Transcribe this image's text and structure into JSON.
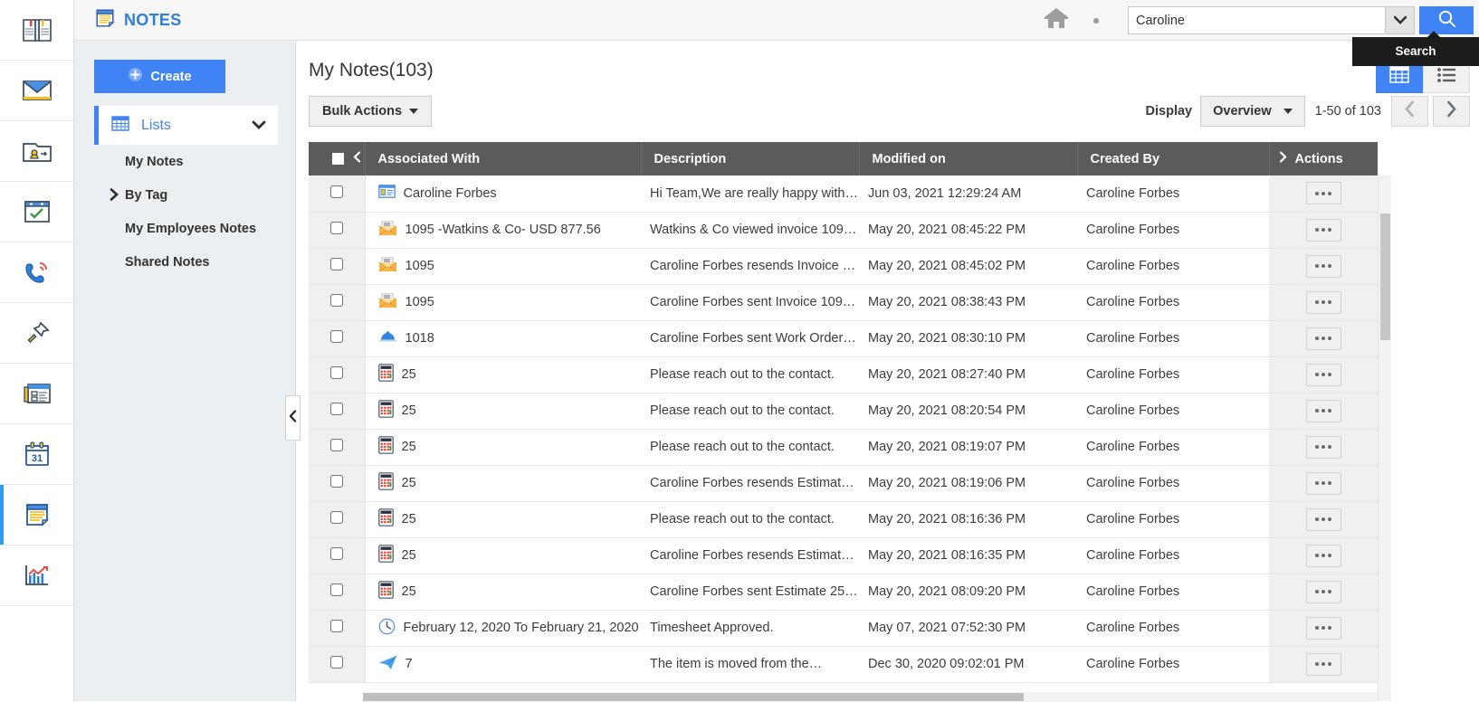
{
  "module": {
    "brand_label": "NOTES",
    "brand_icon": "notes-icon",
    "brand_color": "#2f7ed8"
  },
  "header": {
    "home_icon": "home-icon",
    "more_icon": "ellipsis-icon",
    "search_value": "Caroline",
    "search_placeholder": "Search",
    "search_dropdown_icon": "chevron-down-icon",
    "search_button_icon": "search-icon",
    "tooltip_label": "Search",
    "accent_color": "#3f83f5"
  },
  "icon_rail": [
    {
      "name": "book-icon",
      "label": "Books"
    },
    {
      "name": "envelope-icon",
      "label": "Mail"
    },
    {
      "name": "contacts-icon",
      "label": "Contacts"
    },
    {
      "name": "tasks-icon",
      "label": "Tasks"
    },
    {
      "name": "phone-icon",
      "label": "Calls"
    },
    {
      "name": "pin-icon",
      "label": "Pinned"
    },
    {
      "name": "news-icon",
      "label": "Feeds"
    },
    {
      "name": "calendar-icon",
      "label": "Calendar",
      "badge": "31"
    },
    {
      "name": "notes-icon",
      "label": "Notes",
      "active": true
    },
    {
      "name": "reports-icon",
      "label": "Reports"
    }
  ],
  "nav": {
    "create_label": "Create",
    "create_icon": "plus-circle-icon",
    "lists_label": "Lists",
    "lists_icon": "grid-icon",
    "lists_chevron": "chevron-down-icon",
    "items": [
      {
        "label": "My Notes",
        "has_arrow": false
      },
      {
        "label": "By Tag",
        "has_arrow": true
      },
      {
        "label": "My Employees Notes",
        "has_arrow": false
      },
      {
        "label": "Shared Notes",
        "has_arrow": false
      }
    ],
    "collapse_icon": "chevron-left-icon"
  },
  "main": {
    "page_title": "My Notes(103)",
    "bulk_actions_label": "Bulk Actions",
    "display_label": "Display",
    "display_value": "Overview",
    "range_text": "1-50 of 103",
    "prev_icon": "chevron-left-icon",
    "next_icon": "chevron-right-icon",
    "view_grid_icon": "table-view-icon",
    "view_list_icon": "list-view-icon"
  },
  "table": {
    "select_all_checkbox": false,
    "header_left_chevron": "chevron-left-icon",
    "header_right_chevron": "chevron-right-icon",
    "columns": [
      "Associated With",
      "Description",
      "Modified on",
      "Created By",
      "Actions"
    ],
    "rows": [
      {
        "icon": "contact-card-icon",
        "associated_with": "Caroline Forbes",
        "description": "Hi Team,We are really happy with…",
        "modified_on": "Jun 03, 2021 12:29:24 AM",
        "created_by": "Caroline Forbes",
        "action_icon": "ellipsis-icon"
      },
      {
        "icon": "invoice-envelope-icon",
        "associated_with": "1095 -Watkins & Co- USD 877.56",
        "description": "Watkins & Co viewed invoice 109…",
        "modified_on": "May 20, 2021 08:45:22 PM",
        "created_by": "Caroline Forbes",
        "action_icon": "ellipsis-icon"
      },
      {
        "icon": "invoice-envelope-icon",
        "associated_with": "1095",
        "description": "Caroline Forbes resends Invoice …",
        "modified_on": "May 20, 2021 08:45:02 PM",
        "created_by": "Caroline Forbes",
        "action_icon": "ellipsis-icon"
      },
      {
        "icon": "invoice-envelope-icon",
        "associated_with": "1095",
        "description": "Caroline Forbes sent Invoice 109…",
        "modified_on": "May 20, 2021 08:38:43 PM",
        "created_by": "Caroline Forbes",
        "action_icon": "ellipsis-icon"
      },
      {
        "icon": "hardhat-icon",
        "associated_with": "1018",
        "description": "Caroline Forbes sent Work Order …",
        "modified_on": "May 20, 2021 08:30:10 PM",
        "created_by": "Caroline Forbes",
        "action_icon": "ellipsis-icon"
      },
      {
        "icon": "calculator-icon",
        "associated_with": "25",
        "description": "Please reach out to the contact.",
        "modified_on": "May 20, 2021 08:27:40 PM",
        "created_by": "Caroline Forbes",
        "action_icon": "ellipsis-icon"
      },
      {
        "icon": "calculator-icon",
        "associated_with": "25",
        "description": "Please reach out to the contact.",
        "modified_on": "May 20, 2021 08:20:54 PM",
        "created_by": "Caroline Forbes",
        "action_icon": "ellipsis-icon"
      },
      {
        "icon": "calculator-icon",
        "associated_with": "25",
        "description": "Please reach out to the contact.",
        "modified_on": "May 20, 2021 08:19:07 PM",
        "created_by": "Caroline Forbes",
        "action_icon": "ellipsis-icon"
      },
      {
        "icon": "calculator-icon",
        "associated_with": "25",
        "description": "Caroline Forbes resends Estimat…",
        "modified_on": "May 20, 2021 08:19:06 PM",
        "created_by": "Caroline Forbes",
        "action_icon": "ellipsis-icon"
      },
      {
        "icon": "calculator-icon",
        "associated_with": "25",
        "description": "Please reach out to the contact.",
        "modified_on": "May 20, 2021 08:16:36 PM",
        "created_by": "Caroline Forbes",
        "action_icon": "ellipsis-icon"
      },
      {
        "icon": "calculator-icon",
        "associated_with": "25",
        "description": "Caroline Forbes resends Estimat…",
        "modified_on": "May 20, 2021 08:16:35 PM",
        "created_by": "Caroline Forbes",
        "action_icon": "ellipsis-icon"
      },
      {
        "icon": "calculator-icon",
        "associated_with": "25",
        "description": "Caroline Forbes sent Estimate 25…",
        "modified_on": "May 20, 2021 08:09:20 PM",
        "created_by": "Caroline Forbes",
        "action_icon": "ellipsis-icon"
      },
      {
        "icon": "clock-icon",
        "associated_with": "February 12, 2020 To February 21, 2020",
        "description": "Timesheet Approved.",
        "modified_on": "May 07, 2021 07:52:30 PM",
        "created_by": "Caroline Forbes",
        "action_icon": "ellipsis-icon"
      },
      {
        "icon": "paper-plane-icon",
        "associated_with": "7",
        "description": "The item is moved from the…",
        "modified_on": "Dec 30, 2020 09:02:01 PM",
        "created_by": "Caroline Forbes",
        "action_icon": "ellipsis-icon"
      }
    ]
  }
}
